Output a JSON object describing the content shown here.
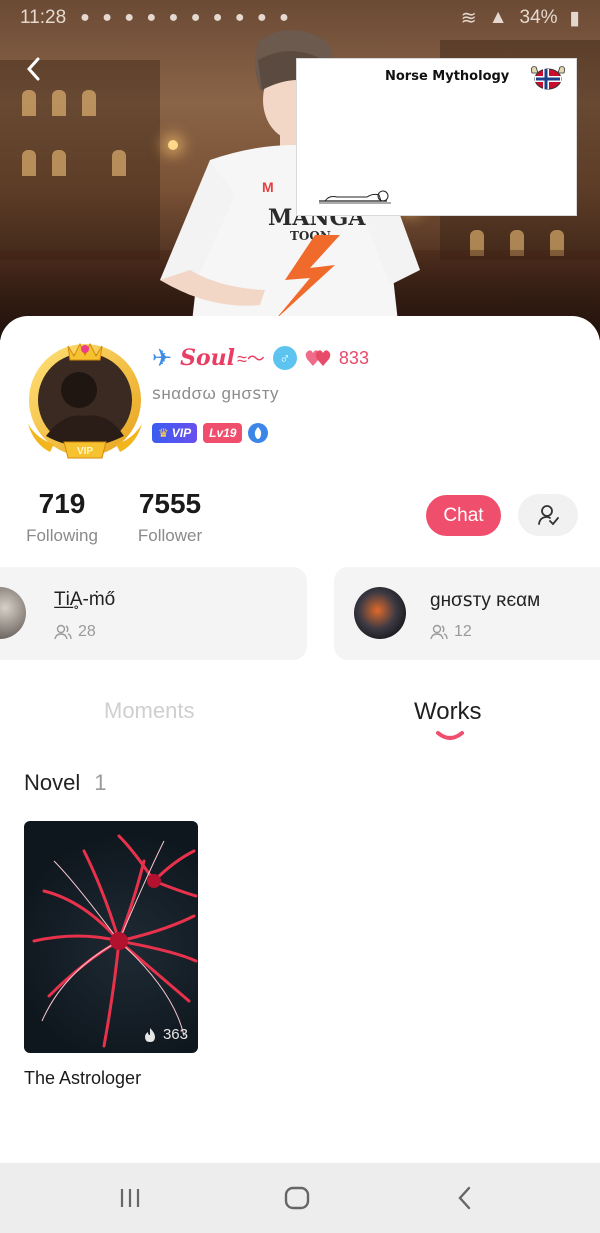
{
  "status_bar": {
    "time": "11:28",
    "battery": "34%"
  },
  "overlay_card": {
    "title": "Norse Mythology"
  },
  "banner_art": {
    "shirt_text": "MANGA",
    "shirt_subtext": "TOON"
  },
  "profile": {
    "name": "Soul",
    "gender_symbol": "♂",
    "likes": "833",
    "handle": "ꜱнαdσω gнσꜱтy",
    "vip_label": "VIP",
    "level_label": "Lv19",
    "avatar_ring_label": "VIP"
  },
  "stats": {
    "following": {
      "value": "719",
      "label": "Following"
    },
    "follower": {
      "value": "7555",
      "label": "Follower"
    }
  },
  "actions": {
    "chat_label": "Chat"
  },
  "groups": [
    {
      "name": "T̲i̲Ḁ-ṁő",
      "members": "28"
    },
    {
      "name": "gнσꜱтy ʀєαм",
      "members": "12"
    }
  ],
  "tabs": [
    {
      "label": "Moments",
      "active": false
    },
    {
      "label": "Works",
      "active": true
    }
  ],
  "works": {
    "section_label": "Novel",
    "section_count": "1",
    "items": [
      {
        "title": "The Astrologer",
        "heat": "363"
      }
    ]
  },
  "colors": {
    "accent": "#f04e6d",
    "name_color": "#e83e63",
    "gender_badge": "#5cc4ef"
  }
}
